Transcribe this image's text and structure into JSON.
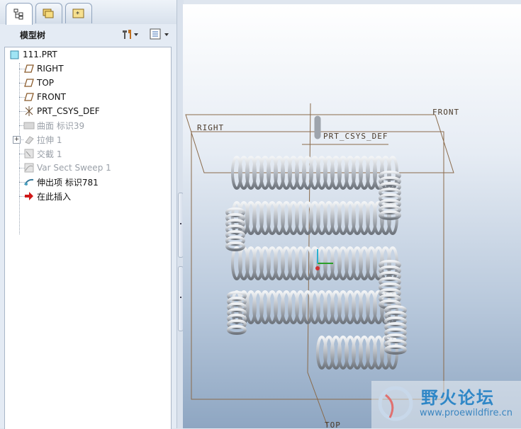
{
  "tabs": [
    {
      "icon": "model-tree-icon",
      "active": true
    },
    {
      "icon": "folder-browser-icon",
      "active": false
    },
    {
      "icon": "favorites-icon",
      "active": false
    }
  ],
  "model_tree": {
    "title": "模型树",
    "settings_icon": "tree-settings-icon",
    "show_icon": "tree-show-icon",
    "items": [
      {
        "label": "111.PRT",
        "icon": "part-icon",
        "dimmed": false
      },
      {
        "label": "RIGHT",
        "icon": "datum-plane-icon",
        "dimmed": false
      },
      {
        "label": "TOP",
        "icon": "datum-plane-icon",
        "dimmed": false
      },
      {
        "label": "FRONT",
        "icon": "datum-plane-icon",
        "dimmed": false
      },
      {
        "label": "PRT_CSYS_DEF",
        "icon": "csys-icon",
        "dimmed": false
      },
      {
        "label": "曲面 标识39",
        "icon": "surface-icon",
        "dimmed": true
      },
      {
        "label": "拉伸 1",
        "icon": "extrude-icon",
        "dimmed": true,
        "expandable": true
      },
      {
        "label": "交截 1",
        "icon": "intersect-icon",
        "dimmed": true
      },
      {
        "label": "Var Sect Sweep 1",
        "icon": "sweep-icon",
        "dimmed": true
      },
      {
        "label": "伸出项 标识781",
        "icon": "protrusion-icon",
        "dimmed": false
      },
      {
        "label": "在此插入",
        "icon": "insert-here-arrow-icon",
        "dimmed": false
      }
    ]
  },
  "viewport": {
    "datum_labels": {
      "front": "FRONT",
      "right": "RIGHT",
      "top": "TOP",
      "csys": "PRT_CSYS_DEF"
    }
  },
  "watermark": {
    "title": "野火论坛",
    "url": "www.proewildfire.cn"
  },
  "colors": {
    "datum": "#8a6a4a",
    "coil": "#b8bcc2",
    "csys_x": "#2aa02a",
    "csys_y": "#2ab0d0",
    "csys_z": "#d03030"
  }
}
